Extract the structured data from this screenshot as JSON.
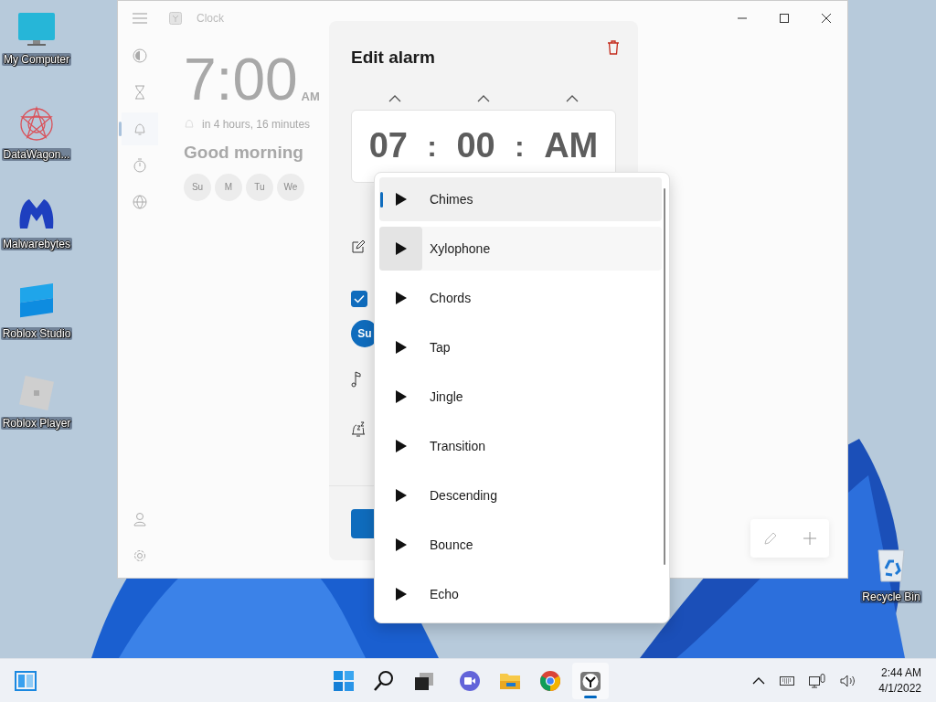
{
  "desktop_icons": [
    {
      "label": "My Computer"
    },
    {
      "label": "DataWagon..."
    },
    {
      "label": "Malwarebytes"
    },
    {
      "label": "Roblox Studio"
    },
    {
      "label": "Roblox Player"
    }
  ],
  "recycle_bin": {
    "label": "Recycle Bin"
  },
  "clock_window": {
    "title": "Clock",
    "nav": [
      {
        "selected": false
      },
      {
        "selected": false
      },
      {
        "selected": true
      },
      {
        "selected": false
      },
      {
        "selected": false
      }
    ],
    "alarm": {
      "time": "7:00",
      "period": "AM",
      "countdown": "in 4 hours, 16 minutes",
      "name": "Good morning",
      "days": [
        "Su",
        "M",
        "Tu",
        "We"
      ]
    }
  },
  "edit_dialog": {
    "title": "Edit alarm",
    "hour": "07",
    "minute": "00",
    "period": "AM",
    "separators": [
      ":",
      ":"
    ],
    "repeat_checked": true,
    "day_chips": [
      {
        "label": "Su",
        "selected": true
      }
    ]
  },
  "sound_menu": {
    "items": [
      {
        "label": "Chimes",
        "selected": true,
        "hovered": false
      },
      {
        "label": "Xylophone",
        "selected": false,
        "hovered": true
      },
      {
        "label": "Chords",
        "selected": false,
        "hovered": false
      },
      {
        "label": "Tap",
        "selected": false,
        "hovered": false
      },
      {
        "label": "Jingle",
        "selected": false,
        "hovered": false
      },
      {
        "label": "Transition",
        "selected": false,
        "hovered": false
      },
      {
        "label": "Descending",
        "selected": false,
        "hovered": false
      },
      {
        "label": "Bounce",
        "selected": false,
        "hovered": false
      },
      {
        "label": "Echo",
        "selected": false,
        "hovered": false
      }
    ]
  },
  "taskbar": {
    "apps": [
      {
        "active": false
      },
      {
        "active": false
      },
      {
        "active": false
      },
      {
        "active": false
      },
      {
        "active": false
      },
      {
        "active": false
      },
      {
        "active": true
      }
    ],
    "time": "2:44 AM",
    "date": "4/1/2022"
  }
}
